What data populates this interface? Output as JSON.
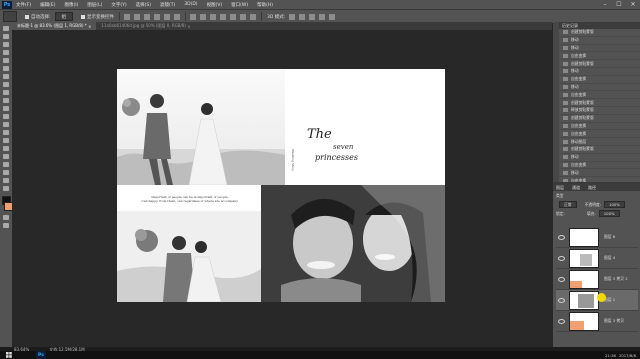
{
  "app": {
    "logo": "Ps"
  },
  "menu": {
    "items": [
      "文件(F)",
      "编辑(E)",
      "图像(I)",
      "图层(L)",
      "文字(Y)",
      "选择(S)",
      "滤镜(T)",
      "3D(D)",
      "视图(V)",
      "窗口(W)",
      "帮助(H)"
    ],
    "window_controls": [
      "–",
      "☐",
      "✕"
    ]
  },
  "options": {
    "auto_select_label": "自动选择:",
    "auto_select_value": "组",
    "show_transform_label": "显示变换控件",
    "mode_label": "3D 模式:"
  },
  "tabs": [
    {
      "label": "未标题-1 @ 83.6% (图层 1, RGB/8) *",
      "close": "×",
      "active": true
    },
    {
      "label": "11a0ab61406d.jpg @ 50% (图层 0, RGB/8)",
      "close": "×",
      "active": false
    }
  ],
  "document": {
    "title_the": "The",
    "title_seven": "seven",
    "title_princesses": "princesses",
    "vertical_text": "Wedding Story",
    "quote_line1": "Important of people can be in important of people.",
    "quote_line2": "Can happy, from them, can regardless of where are accompany."
  },
  "history": {
    "header": "历史记录",
    "items": [
      "创建剪贴蒙版",
      "移动",
      "移动",
      "自由变换",
      "创建剪贴蒙版",
      "移动",
      "自由变换",
      "移动",
      "自由变换",
      "创建剪贴蒙版",
      "释放剪贴蒙版",
      "创建剪贴蒙版",
      "自由变换",
      "自由变换",
      "移动图层",
      "创建剪贴蒙版",
      "移动",
      "自由变换",
      "移动",
      "自由变换"
    ]
  },
  "layers": {
    "tabs": [
      "图层",
      "通道",
      "路径"
    ],
    "kind_label": "类型",
    "blend_mode": "正常",
    "opacity_label": "不透明度:",
    "opacity_value": "100%",
    "lock_label": "锁定:",
    "fill_label": "填充:",
    "fill_value": "100%",
    "rows": [
      {
        "name": "图层 6",
        "selected": false
      },
      {
        "name": "图层 4",
        "selected": false
      },
      {
        "name": "图层 3 拷贝 2",
        "selected": false
      },
      {
        "name": "图层 1",
        "selected": true
      },
      {
        "name": "图层 3 拷贝",
        "selected": false
      }
    ],
    "colors": {
      "thumb_accent": "#f0a070",
      "cursor": "#f5d800"
    }
  },
  "status": {
    "zoom": "83.64%",
    "doc_info": "文档:12.5M/28.1M",
    "time": "21:36",
    "date": "2017/6/8"
  }
}
